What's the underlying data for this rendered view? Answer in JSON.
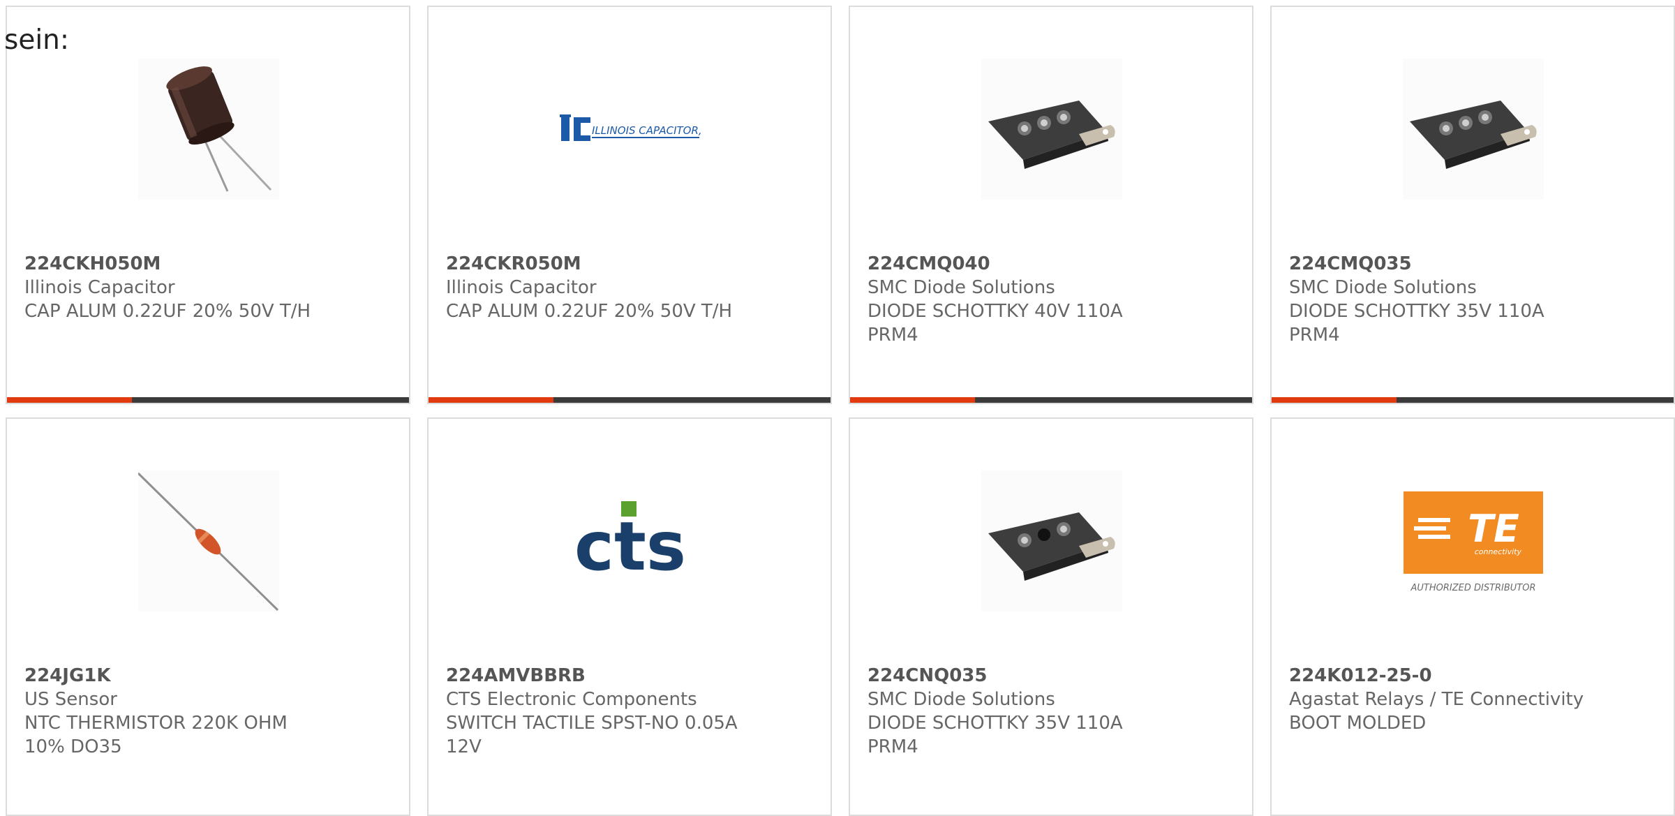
{
  "lead_text": "sein:",
  "accent_color": "#e03a0e",
  "track_color": "#3b3b3b",
  "products": [
    {
      "part_number": "224CKH050M",
      "manufacturer": "Illinois Capacitor",
      "description": "CAP ALUM 0.22UF 20% 50V T/H",
      "image": "electrolytic-capacitor-image",
      "progress": 0.31
    },
    {
      "part_number": "224CKR050M",
      "manufacturer": "Illinois Capacitor",
      "description": "CAP ALUM 0.22UF 20% 50V T/H",
      "image": "illinois-capacitor-logo",
      "logo_text": "ILLINOIS CAPACITOR, INC.",
      "progress": 0.31
    },
    {
      "part_number": "224CMQ040",
      "manufacturer": "SMC Diode Solutions",
      "description": "DIODE SCHOTTKY 40V 110A PRM4",
      "image": "schottky-module-image",
      "progress": 0.31
    },
    {
      "part_number": "224CMQ035",
      "manufacturer": "SMC Diode Solutions",
      "description": "DIODE SCHOTTKY 35V 110A PRM4",
      "image": "schottky-module-image",
      "progress": 0.31
    },
    {
      "part_number": "224JG1K",
      "manufacturer": "US Sensor",
      "description": "NTC THERMISTOR 220K OHM 10% DO35",
      "image": "thermistor-image"
    },
    {
      "part_number": "224AMVBBRB",
      "manufacturer": "CTS Electronic Components",
      "description": "SWITCH TACTILE SPST-NO 0.05A 12V",
      "image": "cts-logo",
      "logo_text": "cts"
    },
    {
      "part_number": "224CNQ035",
      "manufacturer": "SMC Diode Solutions",
      "description": "DIODE SCHOTTKY 35V 110A PRM4",
      "image": "schottky-module-image"
    },
    {
      "part_number": "224K012-25-0",
      "manufacturer": "Agastat Relays / TE Connectivity",
      "description": "BOOT MOLDED",
      "image": "te-connectivity-logo",
      "logo_text": "TE",
      "logo_subtext": "connectivity",
      "logo_caption": "AUTHORIZED DISTRIBUTOR"
    }
  ]
}
